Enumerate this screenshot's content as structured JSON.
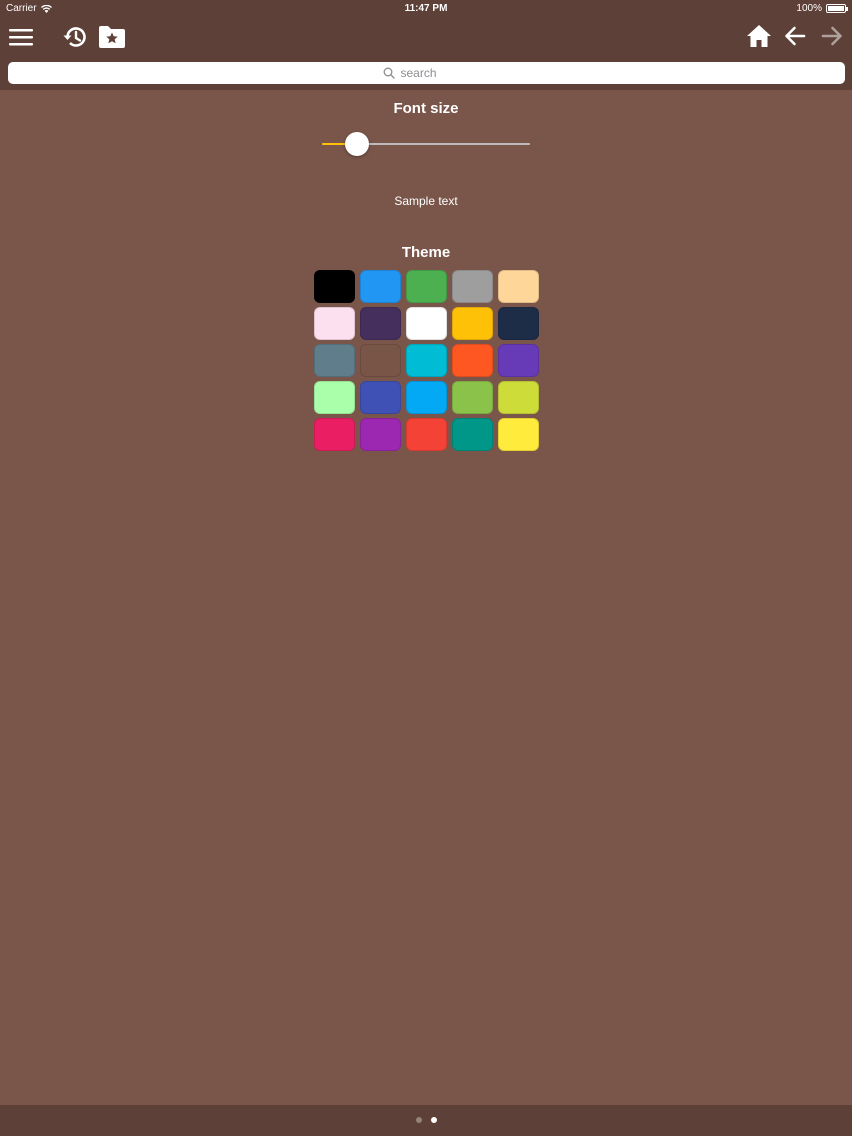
{
  "status_bar": {
    "carrier": "Carrier",
    "time": "11:47 PM",
    "battery": "100%"
  },
  "toolbar": {
    "left_icons": [
      "menu-icon",
      "history-icon",
      "bookmark-folder-icon"
    ],
    "right_icons": [
      "home-icon",
      "back-arrow-icon",
      "forward-arrow-icon"
    ],
    "forward_disabled": true
  },
  "search": {
    "placeholder": "search",
    "value": ""
  },
  "font_size": {
    "title": "Font size",
    "slider_fraction": 0.17,
    "sample_text": "Sample text"
  },
  "theme": {
    "title": "Theme",
    "swatches": [
      "#000000",
      "#2196f3",
      "#4caf50",
      "#9e9e9e",
      "#ffd699",
      "#fde0ef",
      "#452f5c",
      "#ffffff",
      "#ffc107",
      "#1e2d47",
      "#607d8b",
      "#795548",
      "#00bcd4",
      "#ff5722",
      "#673ab7",
      "#aaffaa",
      "#3f51b5",
      "#03a9f4",
      "#8bc34a",
      "#cddc39",
      "#e91e63",
      "#9c27b0",
      "#f44336",
      "#009688",
      "#ffeb3b"
    ]
  },
  "colors": {
    "background": "#7a564a",
    "bar": "#5d4037",
    "accent": "#ffc107"
  },
  "pager": {
    "count": 2,
    "active_index": 1
  }
}
